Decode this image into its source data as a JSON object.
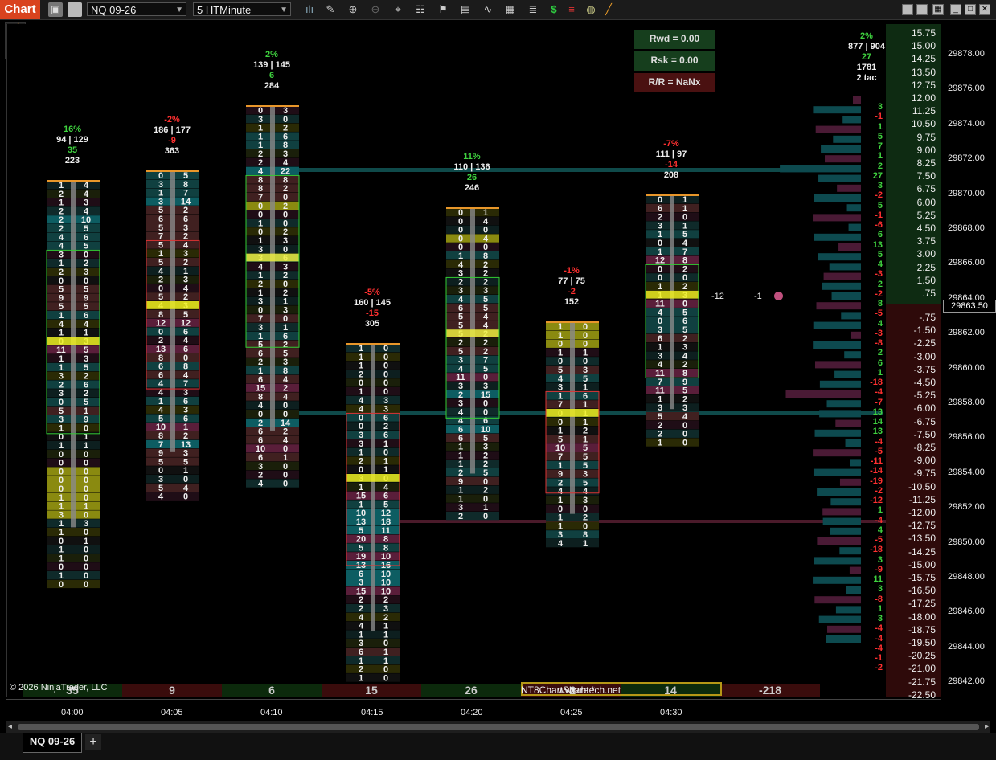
{
  "app": {
    "tab_label": "Chart",
    "instrument": "NQ 09-26",
    "interval": "5 HTMinute",
    "copyright": "© 2026 NinjaTrader, LLC",
    "chart_tab": "NQ 09-26",
    "add_tab": "+",
    "share": "NT8ChartShare *",
    "site": "www.htech.net"
  },
  "rr": {
    "reward": "Rwd =  0.00",
    "risk": "Rsk =  0.00",
    "ratio": "R/R =    NaNx"
  },
  "summary": {
    "pct": "2%",
    "bidask": "877 | 904",
    "delta": "27",
    "vol": "1781",
    "tac": "2 tac"
  },
  "marks": {
    "a": "-12",
    "b": "-1"
  },
  "current_price": "29863.50",
  "price_ticks": [
    "29878.00",
    "29876.00",
    "29874.00",
    "29872.00",
    "29870.00",
    "29868.00",
    "29866.00",
    "29864.00",
    "29862.00",
    "29860.00",
    "29858.00",
    "29856.00",
    "29854.00",
    "29852.00",
    "29850.00",
    "29848.00",
    "29846.00",
    "29844.00",
    "29842.00"
  ],
  "offset_up": [
    "15.75",
    "15.00",
    "14.25",
    "13.50",
    "12.75",
    "12.00",
    "11.25",
    "10.50",
    "9.75",
    "9.00",
    "8.25",
    "7.50",
    "6.75",
    "6.00",
    "5.25",
    "4.50",
    "3.75",
    "3.00",
    "2.25",
    "1.50",
    ".75"
  ],
  "offset_down": [
    "-.75",
    "-1.50",
    "-2.25",
    "-3.00",
    "-3.75",
    "-4.50",
    "-5.25",
    "-6.00",
    "-6.75",
    "-7.50",
    "-8.25",
    "-9.00",
    "-9.75",
    "-10.50",
    "-11.25",
    "-12.00",
    "-12.75",
    "-13.50",
    "-14.25",
    "-15.00",
    "-15.75",
    "-16.50",
    "-17.25",
    "-18.00",
    "-18.75",
    "-19.50",
    "-20.25",
    "-21.00",
    "-21.75",
    "-22.50"
  ],
  "ladder_deltas": [
    "3",
    "-1",
    "1",
    "5",
    "7",
    "1",
    "2",
    "27",
    "3",
    "-2",
    "5",
    "-1",
    "-6",
    "6",
    "13",
    "5",
    "4",
    "-3",
    "2",
    "-2",
    "8",
    "-5",
    "4",
    "-3",
    "-8",
    "2",
    "6",
    "1",
    "-18",
    "-4",
    "-7",
    "13",
    "14",
    "13",
    "-4",
    "-5",
    "-11",
    "-14",
    "-19",
    "-2",
    "-12",
    "1",
    "-4",
    "4",
    "-5",
    "-18",
    "3",
    "-9",
    "11",
    "3",
    "-8",
    "1",
    "3",
    "-4",
    "-4",
    "-4",
    "-1",
    "-2"
  ],
  "times": [
    "04:00",
    "04:05",
    "04:10",
    "04:15",
    "04:20",
    "04:25",
    "04:30"
  ],
  "bar_deltas": [
    "35",
    "9",
    "6",
    "15",
    "26",
    "-2",
    "14",
    "-218"
  ],
  "bars": [
    {
      "pct": "16%",
      "ba": "94 | 129",
      "d": "35",
      "v": "223",
      "pc": "g",
      "dc": "g"
    },
    {
      "pct": "-2%",
      "ba": "186 | 177",
      "d": "-9",
      "v": "363",
      "pc": "r",
      "dc": "r"
    },
    {
      "pct": "2%",
      "ba": "139 | 145",
      "d": "6",
      "v": "284",
      "pc": "g",
      "dc": "g"
    },
    {
      "pct": "-5%",
      "ba": "160 | 145",
      "d": "-15",
      "v": "305",
      "pc": "r",
      "dc": "r"
    },
    {
      "pct": "11%",
      "ba": "110 | 136",
      "d": "26",
      "v": "246",
      "pc": "g",
      "dc": "g"
    },
    {
      "pct": "-1%",
      "ba": "77 | 75",
      "d": "-2",
      "v": "152",
      "pc": "r",
      "dc": "r"
    },
    {
      "pct": "-7%",
      "ba": "111 | 97",
      "d": "-14",
      "v": "208",
      "pc": "r",
      "dc": "r"
    }
  ],
  "cells": [
    [
      [
        "1",
        "4"
      ],
      [
        "2",
        "4"
      ],
      [
        "1",
        "3"
      ],
      [
        "2",
        "4"
      ],
      [
        "2",
        "10"
      ],
      [
        "2",
        "5"
      ],
      [
        "4",
        "6"
      ],
      [
        "4",
        "5"
      ],
      [
        "3",
        "0"
      ],
      [
        "1",
        "2"
      ],
      [
        "2",
        "3"
      ],
      [
        "0",
        "0"
      ],
      [
        "5",
        "5"
      ],
      [
        "9",
        "9"
      ],
      [
        "5",
        "5"
      ],
      [
        "1",
        "6"
      ],
      [
        "4",
        "4"
      ],
      [
        "1",
        "1"
      ],
      [
        "0",
        "3"
      ],
      [
        "11",
        "5"
      ],
      [
        "1",
        "3"
      ],
      [
        "1",
        "5"
      ],
      [
        "3",
        "2"
      ],
      [
        "2",
        "6"
      ],
      [
        "3",
        "2"
      ],
      [
        "0",
        "5"
      ],
      [
        "5",
        "1"
      ],
      [
        "3",
        "9"
      ],
      [
        "1",
        "0"
      ],
      [
        "0",
        "1"
      ],
      [
        "1",
        "1"
      ],
      [
        "0",
        "0"
      ],
      [
        "0",
        "0"
      ],
      [
        "0",
        "0"
      ],
      [
        "0",
        "0"
      ],
      [
        "0",
        "0"
      ],
      [
        "1",
        "0"
      ],
      [
        "1",
        "1"
      ],
      [
        "3",
        "0"
      ],
      [
        "1",
        "3"
      ],
      [
        "1",
        "0"
      ],
      [
        "0",
        "1"
      ],
      [
        "1",
        "0"
      ],
      [
        "1",
        "0"
      ],
      [
        "0",
        "0"
      ],
      [
        "1",
        "0"
      ],
      [
        "0",
        "0"
      ]
    ],
    [
      [
        "0",
        "5"
      ],
      [
        "3",
        "8"
      ],
      [
        "1",
        "7"
      ],
      [
        "3",
        "14"
      ],
      [
        "5",
        "2"
      ],
      [
        "6",
        "6"
      ],
      [
        "5",
        "3"
      ],
      [
        "7",
        "2"
      ],
      [
        "5",
        "4"
      ],
      [
        "1",
        "3"
      ],
      [
        "5",
        "2"
      ],
      [
        "4",
        "1"
      ],
      [
        "2",
        "3"
      ],
      [
        "0",
        "4"
      ],
      [
        "5",
        "2"
      ],
      [
        "4",
        "3"
      ],
      [
        "8",
        "5"
      ],
      [
        "12",
        "12"
      ],
      [
        "0",
        "6"
      ],
      [
        "2",
        "4"
      ],
      [
        "13",
        "6"
      ],
      [
        "8",
        "0"
      ],
      [
        "6",
        "8"
      ],
      [
        "6",
        "4"
      ],
      [
        "4",
        "7"
      ],
      [
        "4",
        "3"
      ],
      [
        "1",
        "6"
      ],
      [
        "4",
        "3"
      ],
      [
        "5",
        "6"
      ],
      [
        "10",
        "1"
      ],
      [
        "8",
        "2"
      ],
      [
        "7",
        "13"
      ],
      [
        "9",
        "3"
      ],
      [
        "5",
        "5"
      ],
      [
        "0",
        "1"
      ],
      [
        "3",
        "0"
      ],
      [
        "5",
        "4"
      ],
      [
        "4",
        "0"
      ]
    ],
    [
      [
        "0",
        "3"
      ],
      [
        "3",
        "0"
      ],
      [
        "1",
        "2"
      ],
      [
        "1",
        "6"
      ],
      [
        "1",
        "8"
      ],
      [
        "2",
        "3"
      ],
      [
        "2",
        "4"
      ],
      [
        "4",
        "22"
      ],
      [
        "8",
        "8"
      ],
      [
        "8",
        "2"
      ],
      [
        "7",
        "0"
      ],
      [
        "0",
        "2"
      ],
      [
        "0",
        "0"
      ],
      [
        "1",
        "0"
      ],
      [
        "0",
        "2"
      ],
      [
        "1",
        "3"
      ],
      [
        "3",
        "0"
      ],
      [
        "3",
        "6"
      ],
      [
        "4",
        "3"
      ],
      [
        "1",
        "2"
      ],
      [
        "2",
        "0"
      ],
      [
        "1",
        "2"
      ],
      [
        "3",
        "1"
      ],
      [
        "0",
        "3"
      ],
      [
        "7",
        "0"
      ],
      [
        "3",
        "1"
      ],
      [
        "1",
        "6"
      ],
      [
        "5",
        "2"
      ],
      [
        "6",
        "5"
      ],
      [
        "2",
        "3"
      ],
      [
        "1",
        "8"
      ],
      [
        "6",
        "4"
      ],
      [
        "15",
        "2"
      ],
      [
        "8",
        "4"
      ],
      [
        "4",
        "0"
      ],
      [
        "0",
        "0"
      ],
      [
        "2",
        "14"
      ],
      [
        "6",
        "2"
      ],
      [
        "6",
        "4"
      ],
      [
        "10",
        "0"
      ],
      [
        "6",
        "1"
      ],
      [
        "3",
        "0"
      ],
      [
        "2",
        "0"
      ],
      [
        "4",
        "0"
      ]
    ],
    [
      [
        "1",
        "0"
      ],
      [
        "1",
        "0"
      ],
      [
        "1",
        "0"
      ],
      [
        "2",
        "0"
      ],
      [
        "0",
        "0"
      ],
      [
        "1",
        "0"
      ],
      [
        "4",
        "3"
      ],
      [
        "4",
        "3"
      ],
      [
        "0",
        "6"
      ],
      [
        "0",
        "2"
      ],
      [
        "3",
        "6"
      ],
      [
        "3",
        "1"
      ],
      [
        "1",
        "0"
      ],
      [
        "2",
        "1"
      ],
      [
        "0",
        "1"
      ],
      [
        "3",
        "0"
      ],
      [
        "1",
        "4"
      ],
      [
        "15",
        "6"
      ],
      [
        "1",
        "5"
      ],
      [
        "10",
        "12"
      ],
      [
        "13",
        "18"
      ],
      [
        "5",
        "11"
      ],
      [
        "20",
        "8"
      ],
      [
        "5",
        "8"
      ],
      [
        "19",
        "10"
      ],
      [
        "13",
        "16"
      ],
      [
        "6",
        "10"
      ],
      [
        "3",
        "10"
      ],
      [
        "15",
        "10"
      ],
      [
        "2",
        "2"
      ],
      [
        "2",
        "3"
      ],
      [
        "4",
        "2"
      ],
      [
        "4",
        "1"
      ],
      [
        "1",
        "1"
      ],
      [
        "3",
        "0"
      ],
      [
        "6",
        "1"
      ],
      [
        "1",
        "1"
      ],
      [
        "2",
        "0"
      ],
      [
        "1",
        "0"
      ]
    ],
    [
      [
        "0",
        "1"
      ],
      [
        "0",
        "4"
      ],
      [
        "0",
        "0"
      ],
      [
        "0",
        "4"
      ],
      [
        "0",
        "0"
      ],
      [
        "1",
        "8"
      ],
      [
        "4",
        "2"
      ],
      [
        "3",
        "2"
      ],
      [
        "2",
        "2"
      ],
      [
        "3",
        "3"
      ],
      [
        "4",
        "5"
      ],
      [
        "6",
        "5"
      ],
      [
        "5",
        "4"
      ],
      [
        "5",
        "4"
      ],
      [
        "5",
        "2"
      ],
      [
        "2",
        "2"
      ],
      [
        "5",
        "2"
      ],
      [
        "3",
        "7"
      ],
      [
        "4",
        "5"
      ],
      [
        "11",
        "0"
      ],
      [
        "3",
        "3"
      ],
      [
        "2",
        "15"
      ],
      [
        "3",
        "0"
      ],
      [
        "4",
        "0"
      ],
      [
        "4",
        "6"
      ],
      [
        "6",
        "10"
      ],
      [
        "6",
        "5"
      ],
      [
        "1",
        "3"
      ],
      [
        "1",
        "2"
      ],
      [
        "1",
        "2"
      ],
      [
        "2",
        "5"
      ],
      [
        "9",
        "0"
      ],
      [
        "1",
        "2"
      ],
      [
        "1",
        "0"
      ],
      [
        "3",
        "1"
      ],
      [
        "2",
        "0"
      ]
    ],
    [
      [
        "1",
        "0"
      ],
      [
        "1",
        "0"
      ],
      [
        "0",
        "0"
      ],
      [
        "1",
        "1"
      ],
      [
        "0",
        "0"
      ],
      [
        "5",
        "3"
      ],
      [
        "4",
        "5"
      ],
      [
        "3",
        "1"
      ],
      [
        "1",
        "6"
      ],
      [
        "7",
        "1"
      ],
      [
        "0",
        "1"
      ],
      [
        "0",
        "1"
      ],
      [
        "1",
        "2"
      ],
      [
        "5",
        "1"
      ],
      [
        "10",
        "5"
      ],
      [
        "7",
        "5"
      ],
      [
        "1",
        "5"
      ],
      [
        "9",
        "3"
      ],
      [
        "2",
        "5"
      ],
      [
        "4",
        "4"
      ],
      [
        "1",
        "3"
      ],
      [
        "0",
        "0"
      ],
      [
        "1",
        "2"
      ],
      [
        "1",
        "0"
      ],
      [
        "3",
        "8"
      ],
      [
        "4",
        "1"
      ]
    ],
    [
      [
        "0",
        "1"
      ],
      [
        "6",
        "1"
      ],
      [
        "2",
        "0"
      ],
      [
        "3",
        "1"
      ],
      [
        "1",
        "5"
      ],
      [
        "0",
        "4"
      ],
      [
        "1",
        "7"
      ],
      [
        "12",
        "8"
      ],
      [
        "0",
        "2"
      ],
      [
        "0",
        "0"
      ],
      [
        "1",
        "2"
      ],
      [
        "1",
        "3"
      ],
      [
        "11",
        "0"
      ],
      [
        "4",
        "5"
      ],
      [
        "0",
        "6"
      ],
      [
        "3",
        "5"
      ],
      [
        "6",
        "2"
      ],
      [
        "1",
        "3"
      ],
      [
        "3",
        "4"
      ],
      [
        "4",
        "2"
      ],
      [
        "11",
        "8"
      ],
      [
        "7",
        "9"
      ],
      [
        "11",
        "5"
      ],
      [
        "1",
        "2"
      ],
      [
        "3",
        "3"
      ],
      [
        "5",
        "4"
      ],
      [
        "2",
        "0"
      ],
      [
        "2",
        "0"
      ],
      [
        "1",
        "0"
      ]
    ]
  ]
}
